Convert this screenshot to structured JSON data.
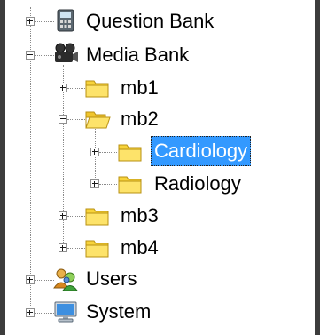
{
  "tree": {
    "question_bank": {
      "label": "Question Bank",
      "icon": "question-bank-icon"
    },
    "media_bank": {
      "label": "Media Bank",
      "icon": "camera-icon"
    },
    "mb1": {
      "label": "mb1",
      "icon": "folder-icon"
    },
    "mb2": {
      "label": "mb2",
      "icon": "folder-open-icon"
    },
    "cardiology": {
      "label": "Cardiology",
      "icon": "folder-icon",
      "selected": true
    },
    "radiology": {
      "label": "Radiology",
      "icon": "folder-icon"
    },
    "mb3": {
      "label": "mb3",
      "icon": "folder-icon"
    },
    "mb4": {
      "label": "mb4",
      "icon": "folder-icon"
    },
    "users": {
      "label": "Users",
      "icon": "users-icon"
    },
    "system": {
      "label": "System",
      "icon": "computer-icon"
    }
  },
  "colors": {
    "selection": "#3399ff",
    "folder": "#f7d33a"
  }
}
